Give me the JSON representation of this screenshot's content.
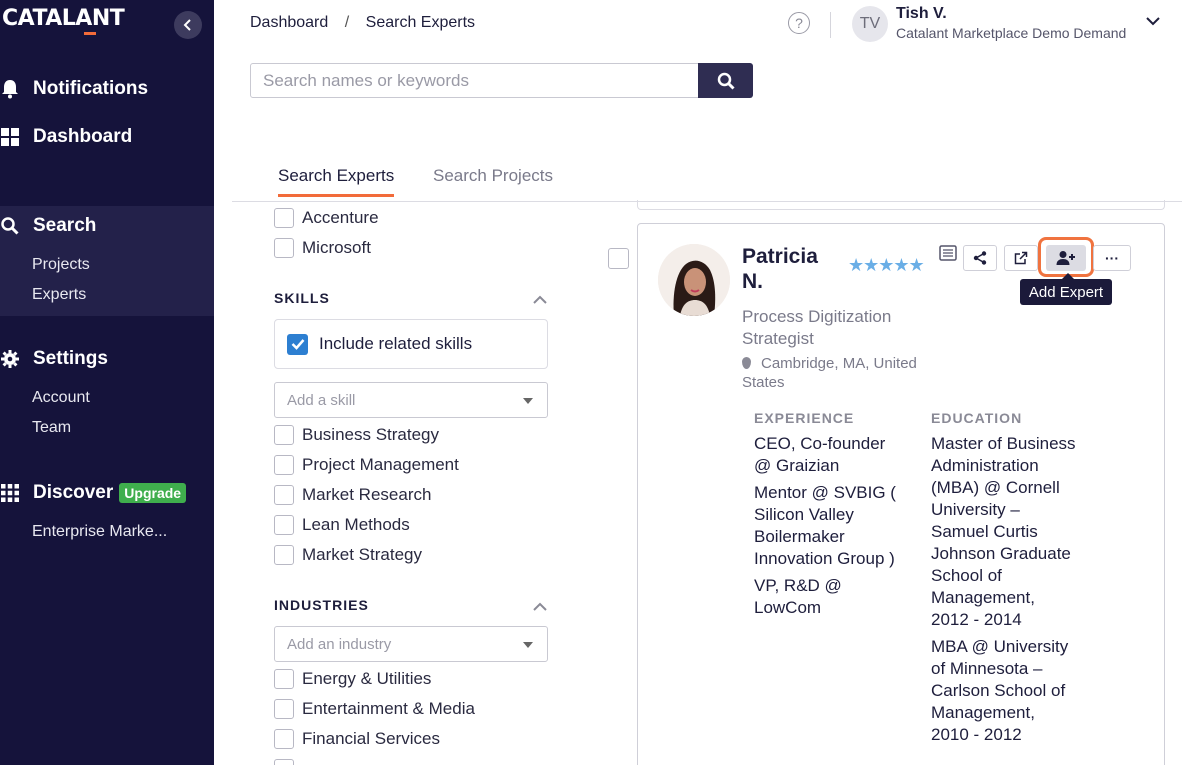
{
  "sidebar": {
    "logo": "CATALANT",
    "nav": {
      "notifications": "Notifications",
      "dashboard": "Dashboard",
      "search": "Search",
      "search_projects": "Projects",
      "search_experts": "Experts",
      "settings": "Settings",
      "settings_account": "Account",
      "settings_team": "Team",
      "discover": "Discover",
      "discover_badge": "Upgrade",
      "discover_enterprise": "Enterprise Marke..."
    }
  },
  "header": {
    "breadcrumb": [
      "Dashboard",
      "Search Experts"
    ],
    "breadcrumb_sep": "/",
    "help": "?",
    "user": {
      "initials": "TV",
      "name": "Tish V.",
      "org": "Catalant Marketplace Demo Demand"
    }
  },
  "search": {
    "placeholder": "Search names or keywords",
    "value": ""
  },
  "tabs": [
    {
      "label": "Search Experts",
      "active": true
    },
    {
      "label": "Search Projects",
      "active": false
    }
  ],
  "filters": {
    "companies": [
      "Accenture",
      "Microsoft"
    ],
    "skills": {
      "heading": "SKILLS",
      "include_related": "Include related skills",
      "include_related_checked": true,
      "placeholder": "Add a skill",
      "options": [
        "Business Strategy",
        "Project Management",
        "Market Research",
        "Lean Methods",
        "Market Strategy"
      ]
    },
    "industries": {
      "heading": "INDUSTRIES",
      "placeholder": "Add an industry",
      "options": [
        "Energy & Utilities",
        "Entertainment & Media",
        "Financial Services"
      ]
    }
  },
  "expert": {
    "name": "Patricia N.",
    "rating": 5,
    "stars": "★★★★★",
    "title": "Process Digitization Strategist",
    "location": "Cambridge, MA, United States",
    "tooltip": "Add Expert",
    "more": "···",
    "experience_heading": "EXPERIENCE",
    "experience": [
      "CEO, Co-founder @ Graizian",
      "Mentor @ SVBIG ( Silicon Valley Boilermaker Innovation Group )",
      "VP, R&D @ LowCom"
    ],
    "education_heading": "EDUCATION",
    "education": [
      "Master of Business Administration (MBA) @ Cornell University – Samuel Curtis Johnson Graduate School of Management, 2012 - 2014",
      "MBA @ University of Minnesota – Carlson School of Management, 2010 - 2012"
    ]
  },
  "colors": {
    "sidebar_bg": "#15133b",
    "accent_orange": "#f26b3a",
    "upgrade_green": "#3fae4d",
    "checkbox_blue": "#2d7fd1",
    "star_blue": "#6aaee6"
  }
}
